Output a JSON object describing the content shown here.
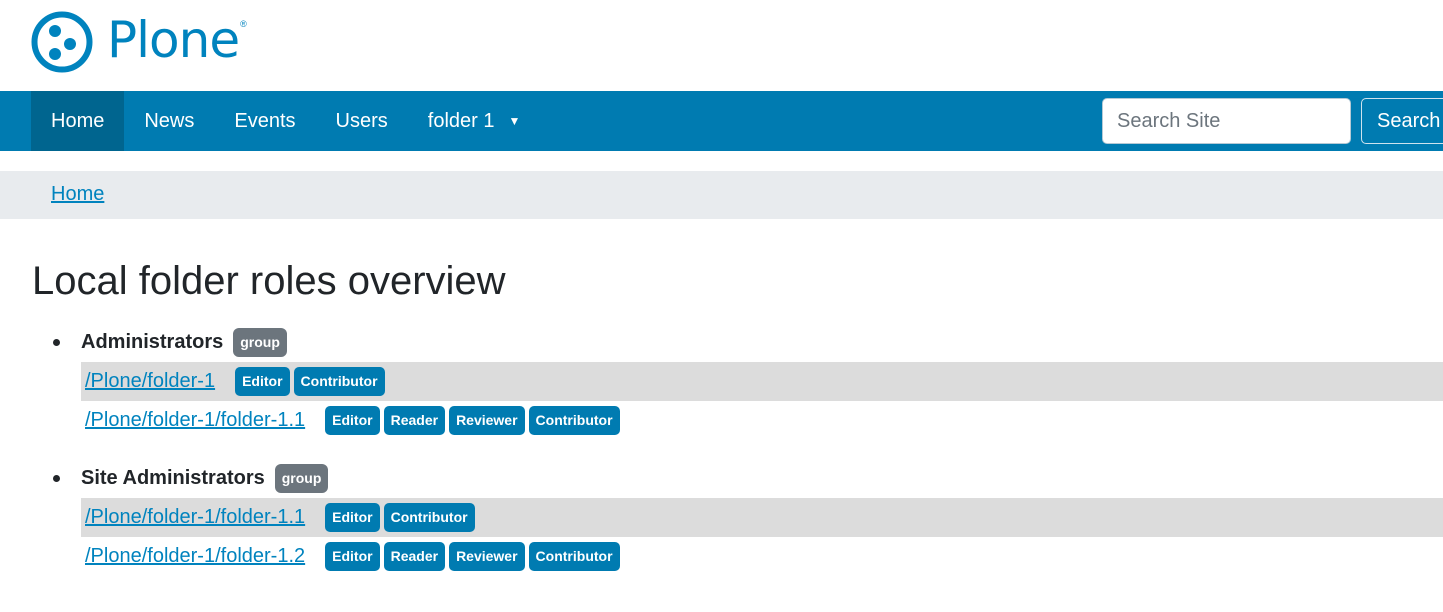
{
  "site": {
    "logo_text": "Plone",
    "logo_mark": "®",
    "brand_color": "#0083be",
    "nav_color": "#007bb1"
  },
  "nav": {
    "items": [
      {
        "label": "Home",
        "active": true
      },
      {
        "label": "News"
      },
      {
        "label": "Events"
      },
      {
        "label": "Users"
      },
      {
        "label": "folder 1",
        "has_dropdown": true,
        "caret": "▼"
      }
    ]
  },
  "search": {
    "placeholder": "Search Site",
    "value": "",
    "button_label": "Search"
  },
  "breadcrumb": {
    "items": [
      {
        "label": "Home"
      }
    ]
  },
  "page": {
    "title": "Local folder roles overview"
  },
  "groups": [
    {
      "name": "Administrators",
      "badge": "group",
      "rows": [
        {
          "path": "/Plone/folder-1",
          "roles": [
            "Editor",
            "Contributor"
          ]
        },
        {
          "path": "/Plone/folder-1/folder-1.1",
          "roles": [
            "Editor",
            "Reader",
            "Reviewer",
            "Contributor"
          ]
        }
      ]
    },
    {
      "name": "Site Administrators",
      "badge": "group",
      "rows": [
        {
          "path": "/Plone/folder-1/folder-1.1",
          "roles": [
            "Editor",
            "Contributor"
          ]
        },
        {
          "path": "/Plone/folder-1/folder-1.2",
          "roles": [
            "Editor",
            "Reader",
            "Reviewer",
            "Contributor"
          ]
        }
      ]
    }
  ]
}
